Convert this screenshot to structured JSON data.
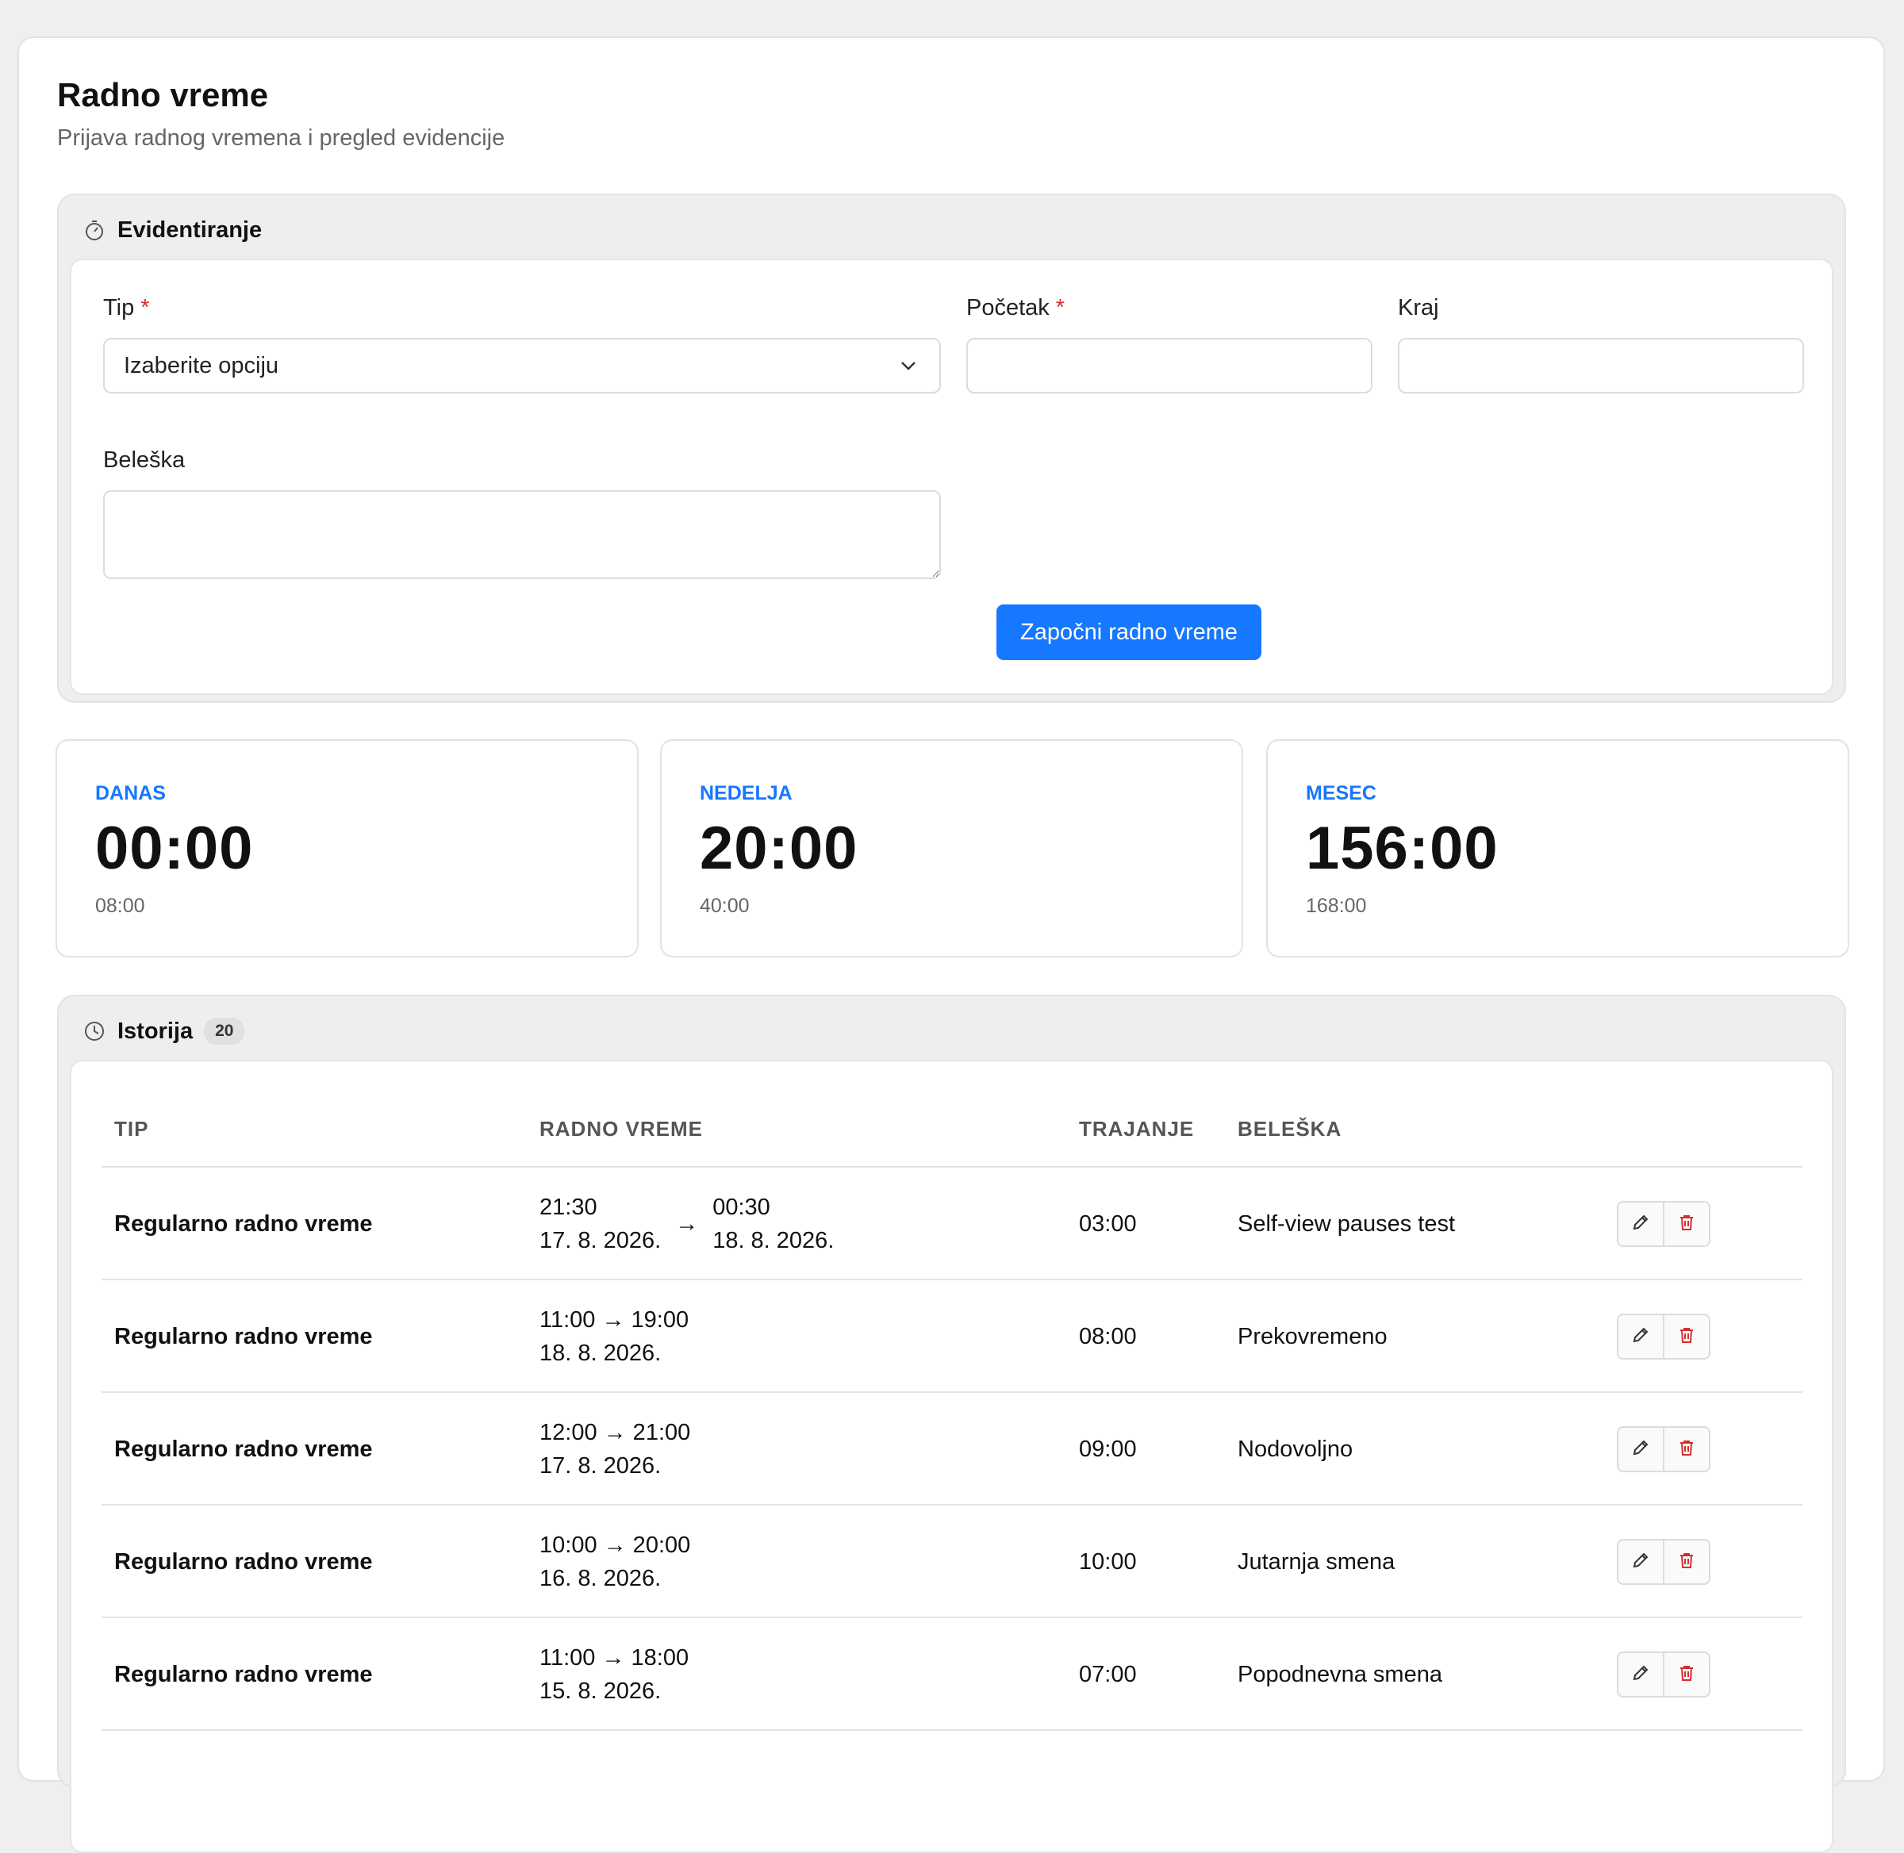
{
  "page": {
    "title": "Radno vreme",
    "subtitle": "Prijava radnog vremena i pregled evidencije"
  },
  "form_panel": {
    "title": "Evidentiranje",
    "icon": "stopwatch-icon",
    "fields": {
      "type_label": "Tip",
      "type_required": "*",
      "type_value": "Izaberite opciju",
      "start_label": "Početak",
      "start_required": "*",
      "end_label": "Kraj",
      "note_label": "Beleška"
    },
    "submit_label": "Započni radno vreme"
  },
  "stats": [
    {
      "label": "DANAS",
      "value": "00:00",
      "target": "08:00"
    },
    {
      "label": "NEDELJA",
      "value": "20:00",
      "target": "40:00"
    },
    {
      "label": "MESEC",
      "value": "156:00",
      "target": "168:00"
    }
  ],
  "history": {
    "title": "Istorija",
    "icon": "clock-icon",
    "count": "20",
    "columns": [
      "TIP",
      "RADNO VREME",
      "TRAJANJE",
      "BELEŠKA"
    ],
    "rows": [
      {
        "type": "Regularno radno vreme",
        "start_time": "21:30",
        "start_date": "17. 8. 2026.",
        "arrow": "→",
        "end_time": "00:30",
        "end_date": "18. 8. 2026.",
        "duration": "03:00",
        "note": "Self-view pauses test"
      },
      {
        "type": "Regularno radno vreme",
        "range": "11:00 → 19:00",
        "date": "18. 8. 2026.",
        "duration": "08:00",
        "note": "Prekovremeno"
      },
      {
        "type": "Regularno radno vreme",
        "range": "12:00 → 21:00",
        "date": "17. 8. 2026.",
        "duration": "09:00",
        "note": "Nodovoljno"
      },
      {
        "type": "Regularno radno vreme",
        "range": "10:00 → 20:00",
        "date": "16. 8. 2026.",
        "duration": "10:00",
        "note": "Jutarnja smena"
      },
      {
        "type": "Regularno radno vreme",
        "range": "11:00 → 18:00",
        "date": "15. 8. 2026.",
        "duration": "07:00",
        "note": "Popodnevna smena"
      }
    ]
  },
  "colors": {
    "accent": "#1677ff",
    "danger": "#d32f2f"
  }
}
